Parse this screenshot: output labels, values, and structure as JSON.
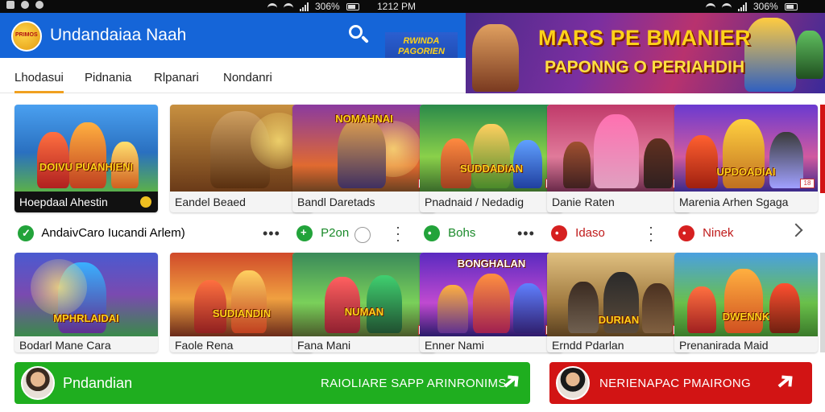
{
  "status_bar": {
    "battery_left": "306%",
    "time": "1212 PM",
    "battery_right": "306%"
  },
  "app": {
    "logo_text": "PRIMOS",
    "title": "Undandaiaa Naah",
    "promo_logo_line1": "RWINDA",
    "promo_logo_line2": "PAGORIEN"
  },
  "banner": {
    "title": "MARS PE BMANIER",
    "subtitle": "PAPONNG O PERIAHDIH"
  },
  "tabs": [
    {
      "label": "Lhodasui",
      "active": true
    },
    {
      "label": "Pidnania",
      "active": false
    },
    {
      "label": "Rlpanari",
      "active": false
    },
    {
      "label": "Nondanri",
      "active": false
    }
  ],
  "row1": [
    {
      "label": "Hoepdaal Ahestin",
      "art_title": "DOIVU PUANHIENI",
      "badge": ""
    },
    {
      "label": "Eandel Beaed",
      "art_title": "",
      "badge": "18"
    },
    {
      "label": "Bandl Daretads",
      "art_title": "NOMAHNAI",
      "badge": "18"
    },
    {
      "label": "Pnadnaid / Nedadig",
      "art_title": "SUDDADIAN",
      "badge": "18"
    },
    {
      "label": "Danie Raten",
      "art_title": "",
      "badge": "18"
    },
    {
      "label": "Marenia Arhen Sgaga",
      "art_title": "UPDOADIAI",
      "badge": "18"
    }
  ],
  "info_row": {
    "first_label": "AndaivCaro Iucandi Arlem)",
    "items": [
      "P2on",
      "Bohs",
      "Idaso",
      "Ninek"
    ]
  },
  "row2": [
    {
      "label": "Bodarl Mane Cara",
      "art_title": "MPHRLAIDAI",
      "badge": ""
    },
    {
      "label": "Faole Rena",
      "art_title": "SUDIANDIN",
      "badge": "18"
    },
    {
      "label": "Fana Mani",
      "art_title": "NUMAN",
      "badge": "18"
    },
    {
      "label": "Enner Nami",
      "art_title": "BONGHALAN",
      "badge": "18"
    },
    {
      "label": "Erndd Pdarlan",
      "art_title": "DURIAN",
      "badge": "18"
    },
    {
      "label": "Prenanirada Maid",
      "art_title": "DWENNK",
      "badge": ""
    }
  ],
  "cta_green": {
    "name": "Pndandian",
    "action": "RAIOLIARE SAPP ARINRONIMS"
  },
  "cta_red": {
    "action": "NERIENAPAC PMAIRONG"
  },
  "colors": {
    "app_blue": "#1565d8",
    "cta_green": "#1fae1f",
    "cta_red": "#d21414",
    "tab_underline": "#f0a020"
  }
}
